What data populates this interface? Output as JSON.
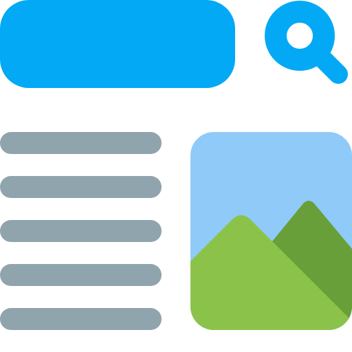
{
  "colors": {
    "search_bar": "#03A9F4",
    "search_icon": "#03A9F4",
    "text_lines": "#90A4AE",
    "image_sky": "#90CAF9",
    "image_mountain_back": "#689F38",
    "image_mountain_front": "#8BC34A"
  },
  "icons": {
    "search": "search-icon",
    "image": "image-icon",
    "mountain_back": "mountain-icon",
    "mountain_front": "mountain-icon"
  },
  "search": {
    "value": "",
    "placeholder": ""
  },
  "text_lines": [
    {
      "name": "text-line-1"
    },
    {
      "name": "text-line-2"
    },
    {
      "name": "text-line-3"
    },
    {
      "name": "text-line-4"
    },
    {
      "name": "text-line-5"
    }
  ]
}
